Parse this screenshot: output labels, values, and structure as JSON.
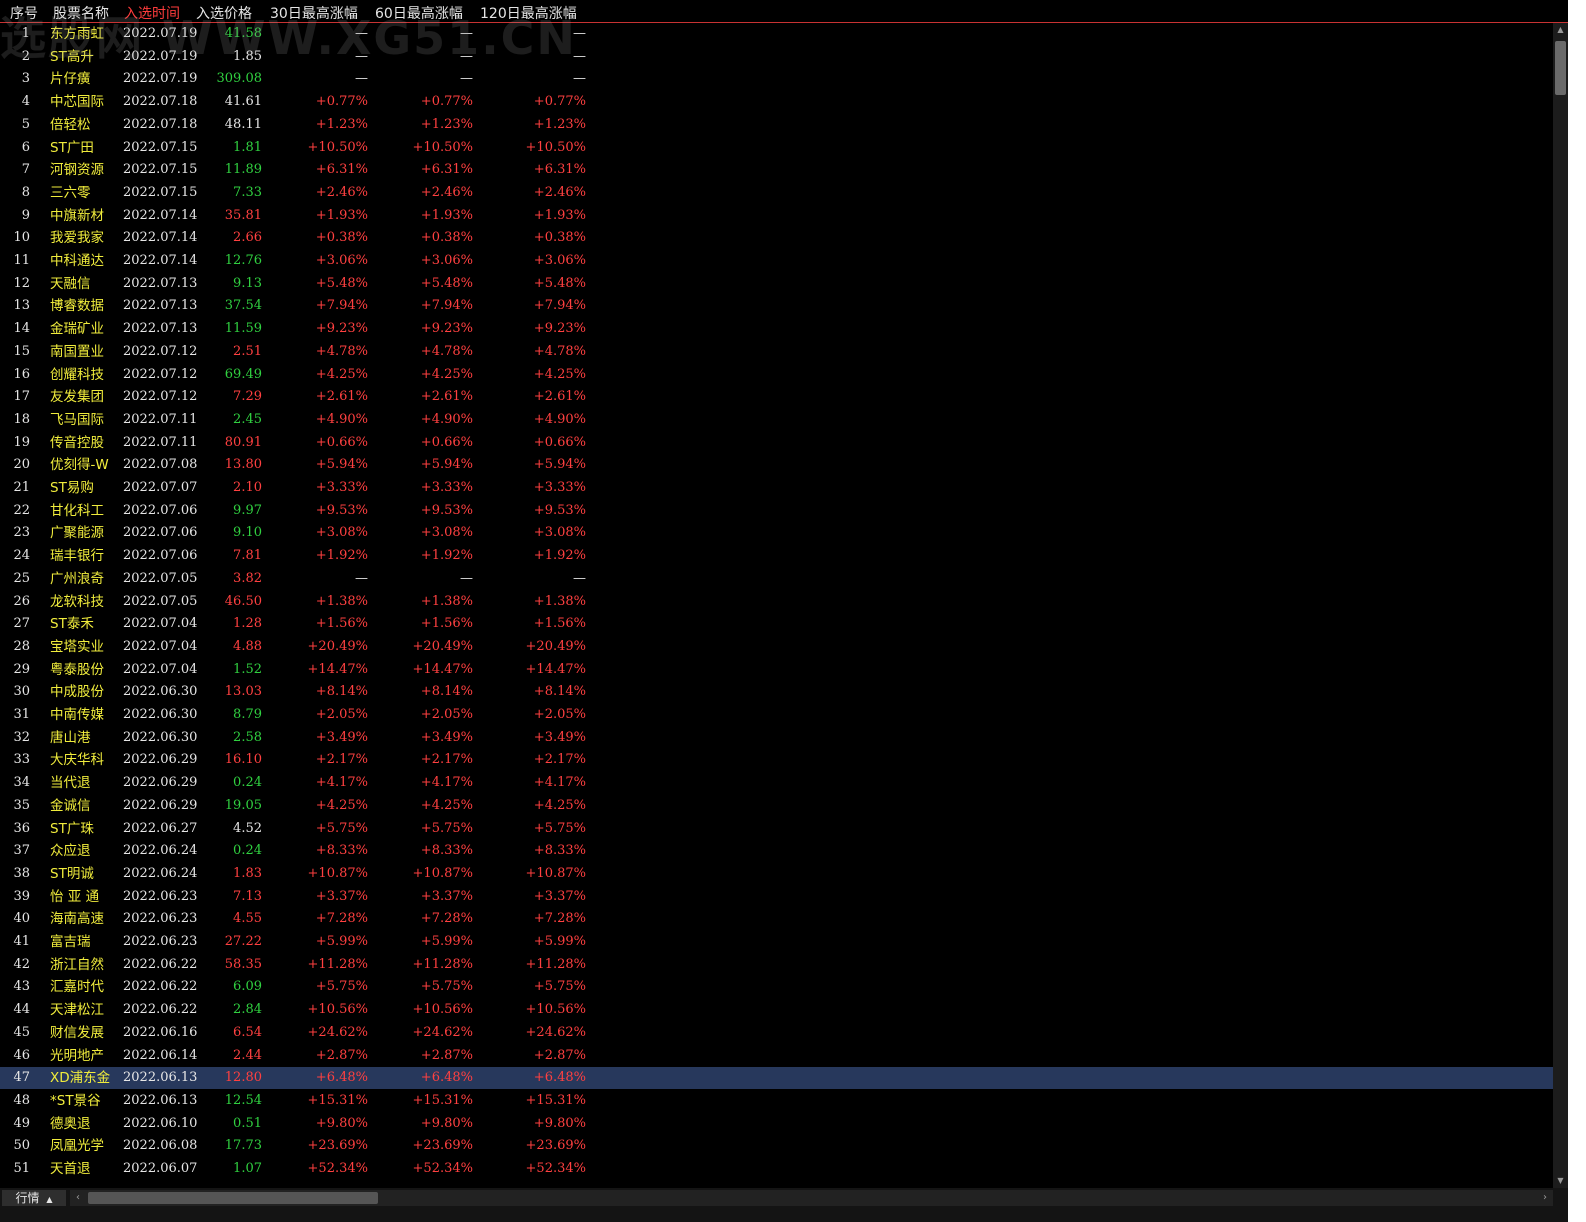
{
  "watermark": "选股网 WWW.XG51.CN",
  "header": {
    "columns": [
      {
        "label": "序号",
        "active": false
      },
      {
        "label": "股票名称",
        "active": false
      },
      {
        "label": "入选时间",
        "active": true
      },
      {
        "label": "入选价格",
        "active": false
      },
      {
        "label": "30日最高涨幅",
        "active": false
      },
      {
        "label": "60日最高涨幅",
        "active": false
      },
      {
        "label": "120日最高涨幅",
        "active": false
      }
    ]
  },
  "colors": {
    "up": "#ff4040",
    "down": "#30d040",
    "flat": "#e6e6e6",
    "name": "#f0ec3c",
    "selected_row": "#27385c",
    "header_border": "#c83232"
  },
  "selected_index": 47,
  "rows": [
    {
      "idx": "1",
      "name": "东方雨虹",
      "date": "2022.07.19",
      "price": "41.58",
      "pc": "down",
      "r30": "—",
      "r60": "—",
      "r120": "—"
    },
    {
      "idx": "2",
      "name": "ST高升",
      "date": "2022.07.19",
      "price": "1.85",
      "pc": "flat",
      "r30": "—",
      "r60": "—",
      "r120": "—"
    },
    {
      "idx": "3",
      "name": "片仔癀",
      "date": "2022.07.19",
      "price": "309.08",
      "pc": "down",
      "r30": "—",
      "r60": "—",
      "r120": "—"
    },
    {
      "idx": "4",
      "name": "中芯国际",
      "date": "2022.07.18",
      "price": "41.61",
      "pc": "flat",
      "r30": "+0.77%",
      "r60": "+0.77%",
      "r120": "+0.77%"
    },
    {
      "idx": "5",
      "name": "倍轻松",
      "date": "2022.07.18",
      "price": "48.11",
      "pc": "flat",
      "r30": "+1.23%",
      "r60": "+1.23%",
      "r120": "+1.23%"
    },
    {
      "idx": "6",
      "name": "ST广田",
      "date": "2022.07.15",
      "price": "1.81",
      "pc": "down",
      "r30": "+10.50%",
      "r60": "+10.50%",
      "r120": "+10.50%"
    },
    {
      "idx": "7",
      "name": "河钢资源",
      "date": "2022.07.15",
      "price": "11.89",
      "pc": "down",
      "r30": "+6.31%",
      "r60": "+6.31%",
      "r120": "+6.31%"
    },
    {
      "idx": "8",
      "name": "三六零",
      "date": "2022.07.15",
      "price": "7.33",
      "pc": "down",
      "r30": "+2.46%",
      "r60": "+2.46%",
      "r120": "+2.46%"
    },
    {
      "idx": "9",
      "name": "中旗新材",
      "date": "2022.07.14",
      "price": "35.81",
      "pc": "up",
      "r30": "+1.93%",
      "r60": "+1.93%",
      "r120": "+1.93%"
    },
    {
      "idx": "10",
      "name": "我爱我家",
      "date": "2022.07.14",
      "price": "2.66",
      "pc": "up",
      "r30": "+0.38%",
      "r60": "+0.38%",
      "r120": "+0.38%"
    },
    {
      "idx": "11",
      "name": "中科通达",
      "date": "2022.07.14",
      "price": "12.76",
      "pc": "down",
      "r30": "+3.06%",
      "r60": "+3.06%",
      "r120": "+3.06%"
    },
    {
      "idx": "12",
      "name": "天融信",
      "date": "2022.07.13",
      "price": "9.13",
      "pc": "down",
      "r30": "+5.48%",
      "r60": "+5.48%",
      "r120": "+5.48%"
    },
    {
      "idx": "13",
      "name": "博睿数据",
      "date": "2022.07.13",
      "price": "37.54",
      "pc": "down",
      "r30": "+7.94%",
      "r60": "+7.94%",
      "r120": "+7.94%"
    },
    {
      "idx": "14",
      "name": "金瑞矿业",
      "date": "2022.07.13",
      "price": "11.59",
      "pc": "down",
      "r30": "+9.23%",
      "r60": "+9.23%",
      "r120": "+9.23%"
    },
    {
      "idx": "15",
      "name": "南国置业",
      "date": "2022.07.12",
      "price": "2.51",
      "pc": "up",
      "r30": "+4.78%",
      "r60": "+4.78%",
      "r120": "+4.78%"
    },
    {
      "idx": "16",
      "name": "创耀科技",
      "date": "2022.07.12",
      "price": "69.49",
      "pc": "down",
      "r30": "+4.25%",
      "r60": "+4.25%",
      "r120": "+4.25%"
    },
    {
      "idx": "17",
      "name": "友发集团",
      "date": "2022.07.12",
      "price": "7.29",
      "pc": "up",
      "r30": "+2.61%",
      "r60": "+2.61%",
      "r120": "+2.61%"
    },
    {
      "idx": "18",
      "name": "飞马国际",
      "date": "2022.07.11",
      "price": "2.45",
      "pc": "down",
      "r30": "+4.90%",
      "r60": "+4.90%",
      "r120": "+4.90%"
    },
    {
      "idx": "19",
      "name": "传音控股",
      "date": "2022.07.11",
      "price": "80.91",
      "pc": "up",
      "r30": "+0.66%",
      "r60": "+0.66%",
      "r120": "+0.66%"
    },
    {
      "idx": "20",
      "name": "优刻得-W",
      "date": "2022.07.08",
      "price": "13.80",
      "pc": "up",
      "r30": "+5.94%",
      "r60": "+5.94%",
      "r120": "+5.94%"
    },
    {
      "idx": "21",
      "name": "ST易购",
      "date": "2022.07.07",
      "price": "2.10",
      "pc": "up",
      "r30": "+3.33%",
      "r60": "+3.33%",
      "r120": "+3.33%"
    },
    {
      "idx": "22",
      "name": "甘化科工",
      "date": "2022.07.06",
      "price": "9.97",
      "pc": "down",
      "r30": "+9.53%",
      "r60": "+9.53%",
      "r120": "+9.53%"
    },
    {
      "idx": "23",
      "name": "广聚能源",
      "date": "2022.07.06",
      "price": "9.10",
      "pc": "down",
      "r30": "+3.08%",
      "r60": "+3.08%",
      "r120": "+3.08%"
    },
    {
      "idx": "24",
      "name": "瑞丰银行",
      "date": "2022.07.06",
      "price": "7.81",
      "pc": "up",
      "r30": "+1.92%",
      "r60": "+1.92%",
      "r120": "+1.92%"
    },
    {
      "idx": "25",
      "name": "广州浪奇",
      "date": "2022.07.05",
      "price": "3.82",
      "pc": "up",
      "r30": "—",
      "r60": "—",
      "r120": "—"
    },
    {
      "idx": "26",
      "name": "龙软科技",
      "date": "2022.07.05",
      "price": "46.50",
      "pc": "up",
      "r30": "+1.38%",
      "r60": "+1.38%",
      "r120": "+1.38%"
    },
    {
      "idx": "27",
      "name": "ST泰禾",
      "date": "2022.07.04",
      "price": "1.28",
      "pc": "up",
      "r30": "+1.56%",
      "r60": "+1.56%",
      "r120": "+1.56%"
    },
    {
      "idx": "28",
      "name": "宝塔实业",
      "date": "2022.07.04",
      "price": "4.88",
      "pc": "up",
      "r30": "+20.49%",
      "r60": "+20.49%",
      "r120": "+20.49%"
    },
    {
      "idx": "29",
      "name": "粤泰股份",
      "date": "2022.07.04",
      "price": "1.52",
      "pc": "down",
      "r30": "+14.47%",
      "r60": "+14.47%",
      "r120": "+14.47%"
    },
    {
      "idx": "30",
      "name": "中成股份",
      "date": "2022.06.30",
      "price": "13.03",
      "pc": "up",
      "r30": "+8.14%",
      "r60": "+8.14%",
      "r120": "+8.14%"
    },
    {
      "idx": "31",
      "name": "中南传媒",
      "date": "2022.06.30",
      "price": "8.79",
      "pc": "down",
      "r30": "+2.05%",
      "r60": "+2.05%",
      "r120": "+2.05%"
    },
    {
      "idx": "32",
      "name": "唐山港",
      "date": "2022.06.30",
      "price": "2.58",
      "pc": "down",
      "r30": "+3.49%",
      "r60": "+3.49%",
      "r120": "+3.49%"
    },
    {
      "idx": "33",
      "name": "大庆华科",
      "date": "2022.06.29",
      "price": "16.10",
      "pc": "up",
      "r30": "+2.17%",
      "r60": "+2.17%",
      "r120": "+2.17%"
    },
    {
      "idx": "34",
      "name": "当代退",
      "date": "2022.06.29",
      "price": "0.24",
      "pc": "down",
      "r30": "+4.17%",
      "r60": "+4.17%",
      "r120": "+4.17%"
    },
    {
      "idx": "35",
      "name": "金诚信",
      "date": "2022.06.29",
      "price": "19.05",
      "pc": "down",
      "r30": "+4.25%",
      "r60": "+4.25%",
      "r120": "+4.25%"
    },
    {
      "idx": "36",
      "name": "ST广珠",
      "date": "2022.06.27",
      "price": "4.52",
      "pc": "flat",
      "r30": "+5.75%",
      "r60": "+5.75%",
      "r120": "+5.75%"
    },
    {
      "idx": "37",
      "name": "众应退",
      "date": "2022.06.24",
      "price": "0.24",
      "pc": "down",
      "r30": "+8.33%",
      "r60": "+8.33%",
      "r120": "+8.33%"
    },
    {
      "idx": "38",
      "name": "ST明诚",
      "date": "2022.06.24",
      "price": "1.83",
      "pc": "up",
      "r30": "+10.87%",
      "r60": "+10.87%",
      "r120": "+10.87%"
    },
    {
      "idx": "39",
      "name": "怡 亚 通",
      "date": "2022.06.23",
      "price": "7.13",
      "pc": "up",
      "r30": "+3.37%",
      "r60": "+3.37%",
      "r120": "+3.37%"
    },
    {
      "idx": "40",
      "name": "海南高速",
      "date": "2022.06.23",
      "price": "4.55",
      "pc": "up",
      "r30": "+7.28%",
      "r60": "+7.28%",
      "r120": "+7.28%"
    },
    {
      "idx": "41",
      "name": "富吉瑞",
      "date": "2022.06.23",
      "price": "27.22",
      "pc": "up",
      "r30": "+5.99%",
      "r60": "+5.99%",
      "r120": "+5.99%"
    },
    {
      "idx": "42",
      "name": "浙江自然",
      "date": "2022.06.22",
      "price": "58.35",
      "pc": "up",
      "r30": "+11.28%",
      "r60": "+11.28%",
      "r120": "+11.28%"
    },
    {
      "idx": "43",
      "name": "汇嘉时代",
      "date": "2022.06.22",
      "price": "6.09",
      "pc": "down",
      "r30": "+5.75%",
      "r60": "+5.75%",
      "r120": "+5.75%"
    },
    {
      "idx": "44",
      "name": "天津松江",
      "date": "2022.06.22",
      "price": "2.84",
      "pc": "down",
      "r30": "+10.56%",
      "r60": "+10.56%",
      "r120": "+10.56%"
    },
    {
      "idx": "45",
      "name": "财信发展",
      "date": "2022.06.16",
      "price": "6.54",
      "pc": "up",
      "r30": "+24.62%",
      "r60": "+24.62%",
      "r120": "+24.62%"
    },
    {
      "idx": "46",
      "name": "光明地产",
      "date": "2022.06.14",
      "price": "2.44",
      "pc": "up",
      "r30": "+2.87%",
      "r60": "+2.87%",
      "r120": "+2.87%"
    },
    {
      "idx": "47",
      "name": "XD浦东金",
      "date": "2022.06.13",
      "price": "12.80",
      "pc": "up",
      "r30": "+6.48%",
      "r60": "+6.48%",
      "r120": "+6.48%"
    },
    {
      "idx": "48",
      "name": "*ST景谷",
      "date": "2022.06.13",
      "price": "12.54",
      "pc": "down",
      "r30": "+15.31%",
      "r60": "+15.31%",
      "r120": "+15.31%"
    },
    {
      "idx": "49",
      "name": "德奥退",
      "date": "2022.06.10",
      "price": "0.51",
      "pc": "down",
      "r30": "+9.80%",
      "r60": "+9.80%",
      "r120": "+9.80%"
    },
    {
      "idx": "50",
      "name": "凤凰光学",
      "date": "2022.06.08",
      "price": "17.73",
      "pc": "down",
      "r30": "+23.69%",
      "r60": "+23.69%",
      "r120": "+23.69%"
    },
    {
      "idx": "51",
      "name": "天首退",
      "date": "2022.06.07",
      "price": "1.07",
      "pc": "down",
      "r30": "+52.34%",
      "r60": "+52.34%",
      "r120": "+52.34%"
    }
  ],
  "bottom": {
    "tab_label": "行情",
    "tab_icon": "caret-up-icon"
  },
  "scroll": {
    "vertical_position": 0.0,
    "horizontal_position": 0.0
  }
}
